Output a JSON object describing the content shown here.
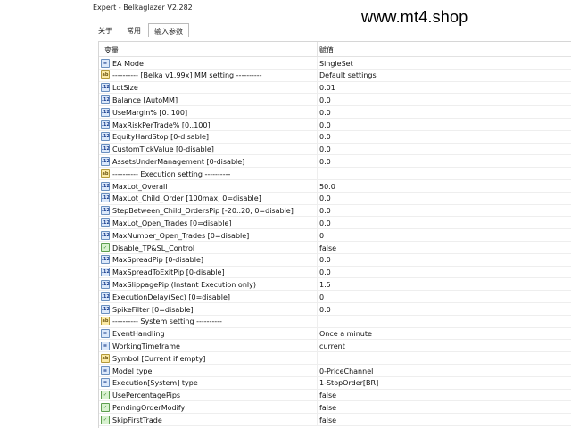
{
  "window": {
    "title": "Expert - Belkaglazer V2.282"
  },
  "watermark": "www.mt4.shop",
  "tabs": [
    {
      "label": "关于",
      "active": false
    },
    {
      "label": "常用",
      "active": false
    },
    {
      "label": "输入参数",
      "active": true
    }
  ],
  "table": {
    "headers": {
      "variable": "变量",
      "value": "赋值"
    },
    "rows": [
      {
        "icon": "enum-icon",
        "name": "EA Mode",
        "value": "SingleSet"
      },
      {
        "icon": "string-icon",
        "name": "---------- [Belka v1.99x] MM setting ----------",
        "value": "Default settings"
      },
      {
        "icon": "number-icon",
        "name": "LotSize",
        "value": "0.01"
      },
      {
        "icon": "number-icon",
        "name": "Balance [AutoMM]",
        "value": "0.0"
      },
      {
        "icon": "number-icon",
        "name": "UseMargin% [0..100]",
        "value": "0.0"
      },
      {
        "icon": "number-icon",
        "name": "MaxRiskPerTrade% [0..100]",
        "value": "0.0"
      },
      {
        "icon": "number-icon",
        "name": "EquityHardStop [0-disable]",
        "value": "0.0"
      },
      {
        "icon": "number-icon",
        "name": "CustomTickValue [0-disable]",
        "value": "0.0"
      },
      {
        "icon": "number-icon",
        "name": "AssetsUnderManagement [0-disable]",
        "value": "0.0"
      },
      {
        "icon": "string-icon",
        "name": "---------- Execution setting ----------",
        "value": ""
      },
      {
        "icon": "number-icon",
        "name": "MaxLot_Overall",
        "value": "50.0"
      },
      {
        "icon": "number-icon",
        "name": "MaxLot_Child_Order [100max, 0=disable]",
        "value": "0.0"
      },
      {
        "icon": "number-icon",
        "name": "StepBetween_Child_OrdersPip [-20..20, 0=disable]",
        "value": "0.0"
      },
      {
        "icon": "number-icon",
        "name": "MaxLot_Open_Trades [0=disable]",
        "value": "0.0"
      },
      {
        "icon": "number-icon",
        "name": "MaxNumber_Open_Trades [0=disable]",
        "value": "0"
      },
      {
        "icon": "bool-icon",
        "name": "Disable_TP&SL_Control",
        "value": "false"
      },
      {
        "icon": "number-icon",
        "name": "MaxSpreadPip [0-disable]",
        "value": "0.0"
      },
      {
        "icon": "number-icon",
        "name": "MaxSpreadToExitPip [0-disable]",
        "value": "0.0"
      },
      {
        "icon": "number-icon",
        "name": "MaxSlippagePip (Instant Execution only)",
        "value": "1.5"
      },
      {
        "icon": "number-icon",
        "name": "ExecutionDelay(Sec) [0=disable]",
        "value": "0"
      },
      {
        "icon": "number-icon",
        "name": "SpikeFilter [0=disable]",
        "value": "0.0"
      },
      {
        "icon": "string-icon",
        "name": "---------- System setting ----------",
        "value": ""
      },
      {
        "icon": "enum-icon",
        "name": "EventHandling",
        "value": "Once a minute"
      },
      {
        "icon": "enum-icon",
        "name": "WorkingTimeframe",
        "value": "current"
      },
      {
        "icon": "string-icon",
        "name": "Symbol [Current if empty]",
        "value": ""
      },
      {
        "icon": "enum-icon",
        "name": "Model type",
        "value": "0-PriceChannel"
      },
      {
        "icon": "enum-icon",
        "name": "Execution[System] type",
        "value": "1-StopOrder[BR]"
      },
      {
        "icon": "bool-icon",
        "name": "UsePercentagePips",
        "value": "false"
      },
      {
        "icon": "bool-icon",
        "name": "PendingOrderModify",
        "value": "false"
      },
      {
        "icon": "bool-icon",
        "name": "SkipFirstTrade",
        "value": "false"
      }
    ]
  }
}
